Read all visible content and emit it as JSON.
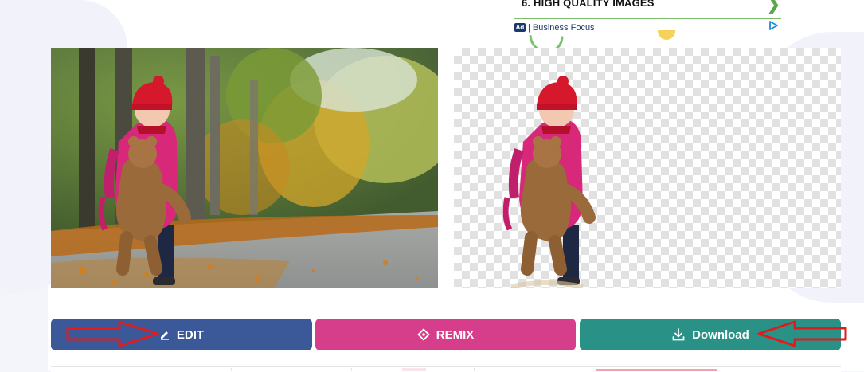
{
  "ad": {
    "title": "6.  HIGH QUALITY IMAGES",
    "badge": "Ad",
    "source": "| Business Focus",
    "chevron": "❯",
    "accent": "#7dbb6b",
    "icons": [
      "chevron-right-icon",
      "adchoices-play-icon"
    ]
  },
  "images": {
    "original": "child-with-teddy-bear-photo",
    "result": "background-removed-cutout"
  },
  "actions": {
    "edit_label": "EDIT",
    "remix_label": "REMIX",
    "download_label": "Download",
    "colors": {
      "edit": "#3b5998",
      "remix": "#d63e8b",
      "download": "#2a9187",
      "annotation_arrow": "#e01b1b"
    },
    "icons": {
      "edit": "pencil-icon",
      "remix": "diamond-icon",
      "download": "download-icon"
    }
  }
}
